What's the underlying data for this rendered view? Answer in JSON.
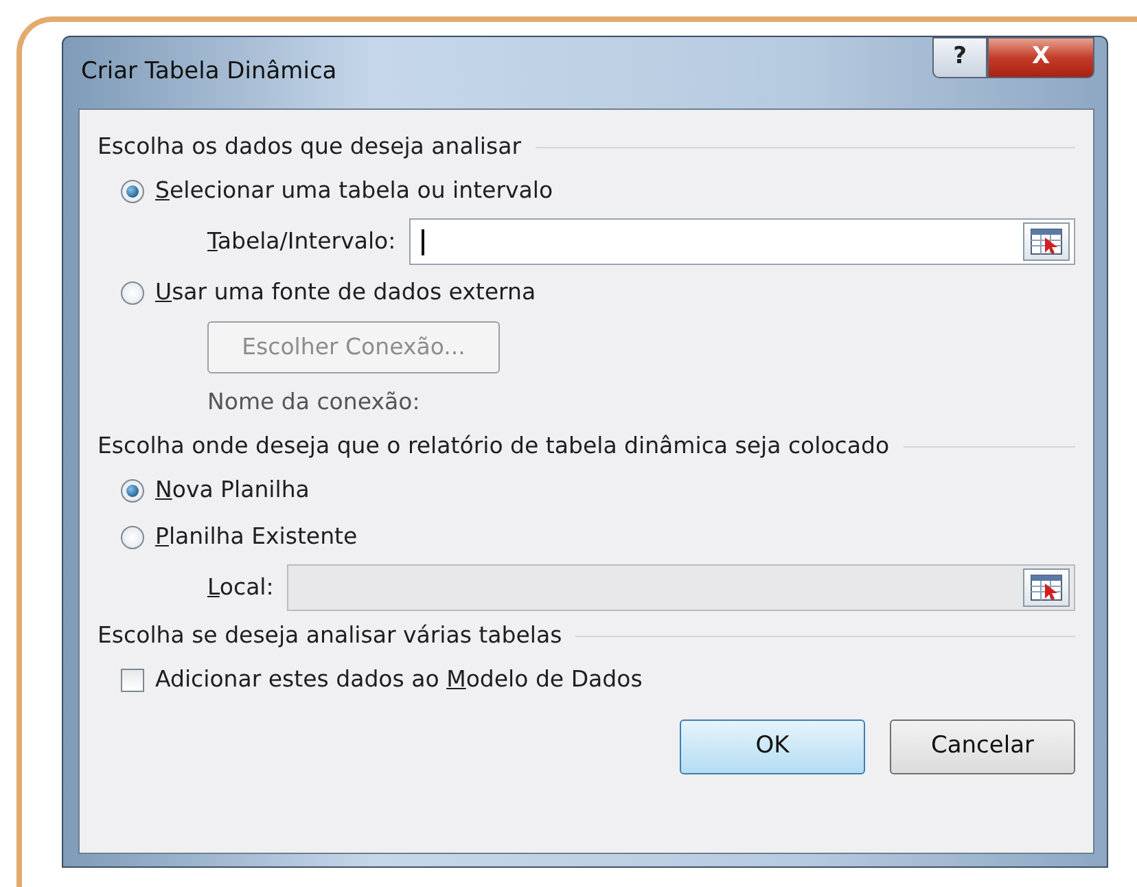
{
  "window": {
    "title": "Criar Tabela Dinâmica",
    "buttons": [
      {
        "kind": "help",
        "label": "?"
      },
      {
        "kind": "close",
        "label": "X"
      }
    ]
  },
  "sections": [
    {
      "heading": "Escolha os dados que deseja analisar",
      "items": [
        {
          "kind": "radio",
          "key": "S",
          "rest": "elecionar uma tabela ou intervalo",
          "selected": true
        },
        {
          "kind": "range",
          "key": "T",
          "rest": "abela/Intervalo:",
          "value": "",
          "focused": true,
          "disabled": false
        },
        {
          "kind": "radio",
          "key": "U",
          "rest": "sar uma fonte de dados externa",
          "selected": false
        },
        {
          "kind": "button",
          "label": "Escolher Conexão...",
          "disabled": true
        },
        {
          "kind": "note",
          "label": "Nome da conexão:",
          "disabled": true
        }
      ]
    },
    {
      "heading": "Escolha onde deseja que o relatório de tabela dinâmica seja colocado",
      "items": [
        {
          "kind": "radio",
          "key": "N",
          "rest": "ova Planilha",
          "selected": true
        },
        {
          "kind": "radio",
          "key": "P",
          "rest": "lanilha Existente",
          "selected": false
        },
        {
          "kind": "range",
          "key": "L",
          "rest": "ocal:",
          "value": "",
          "focused": false,
          "disabled": true
        }
      ]
    },
    {
      "heading": "Escolha se deseja analisar várias tabelas",
      "items": [
        {
          "kind": "checkbox",
          "pre": "Adicionar estes dados ao ",
          "key": "M",
          "rest": "odelo de Dados",
          "checked": false
        }
      ]
    }
  ],
  "buttons": [
    {
      "label": "OK",
      "default": true
    },
    {
      "label": "Cancelar",
      "default": false
    }
  ]
}
